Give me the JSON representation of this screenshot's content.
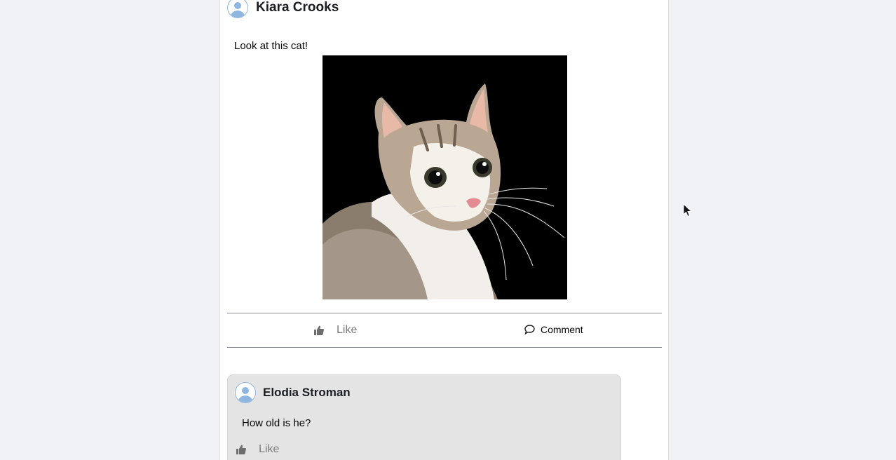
{
  "post": {
    "author": "Kiara Crooks",
    "text": "Look at this cat!",
    "image_icon": "cat-photo",
    "actions": {
      "like_label": "Like",
      "like_icon": "thumbs-up-icon",
      "comment_label": "Comment",
      "comment_icon": "speech-bubble-icon"
    }
  },
  "comments": [
    {
      "author": "Elodia Stroman",
      "text": "How old is he?",
      "like_label": "Like"
    }
  ],
  "colors": {
    "page_background": "#f0f2f5",
    "card_background": "#ffffff",
    "comment_background": "#e4e4e4",
    "avatar_accent": "#8fb6df",
    "muted_text": "#7a7a7a"
  }
}
